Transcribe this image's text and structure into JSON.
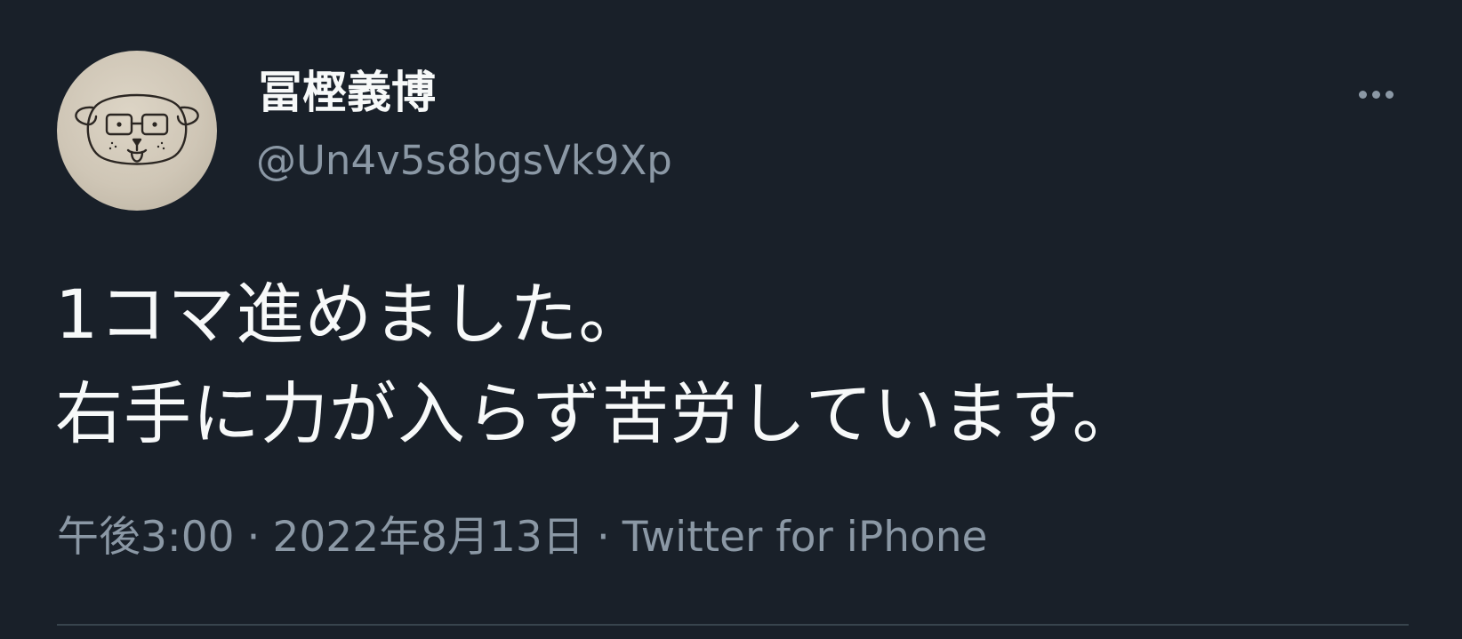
{
  "tweet": {
    "author": {
      "display_name": "冨樫義博",
      "handle": "@Un4v5s8bgsVk9Xp"
    },
    "more_icon": "more-horizontal-icon",
    "text_lines": [
      "1コマ進めました。",
      "右手に力が入らず苦労しています。"
    ],
    "time": "午後3:00",
    "separator": "·",
    "date": "2022年8月13日",
    "source": "Twitter for iPhone"
  },
  "colors": {
    "background": "#192029",
    "primary_text": "#f7f9f9",
    "secondary_text": "#8b98a5",
    "divider": "#38444d"
  }
}
